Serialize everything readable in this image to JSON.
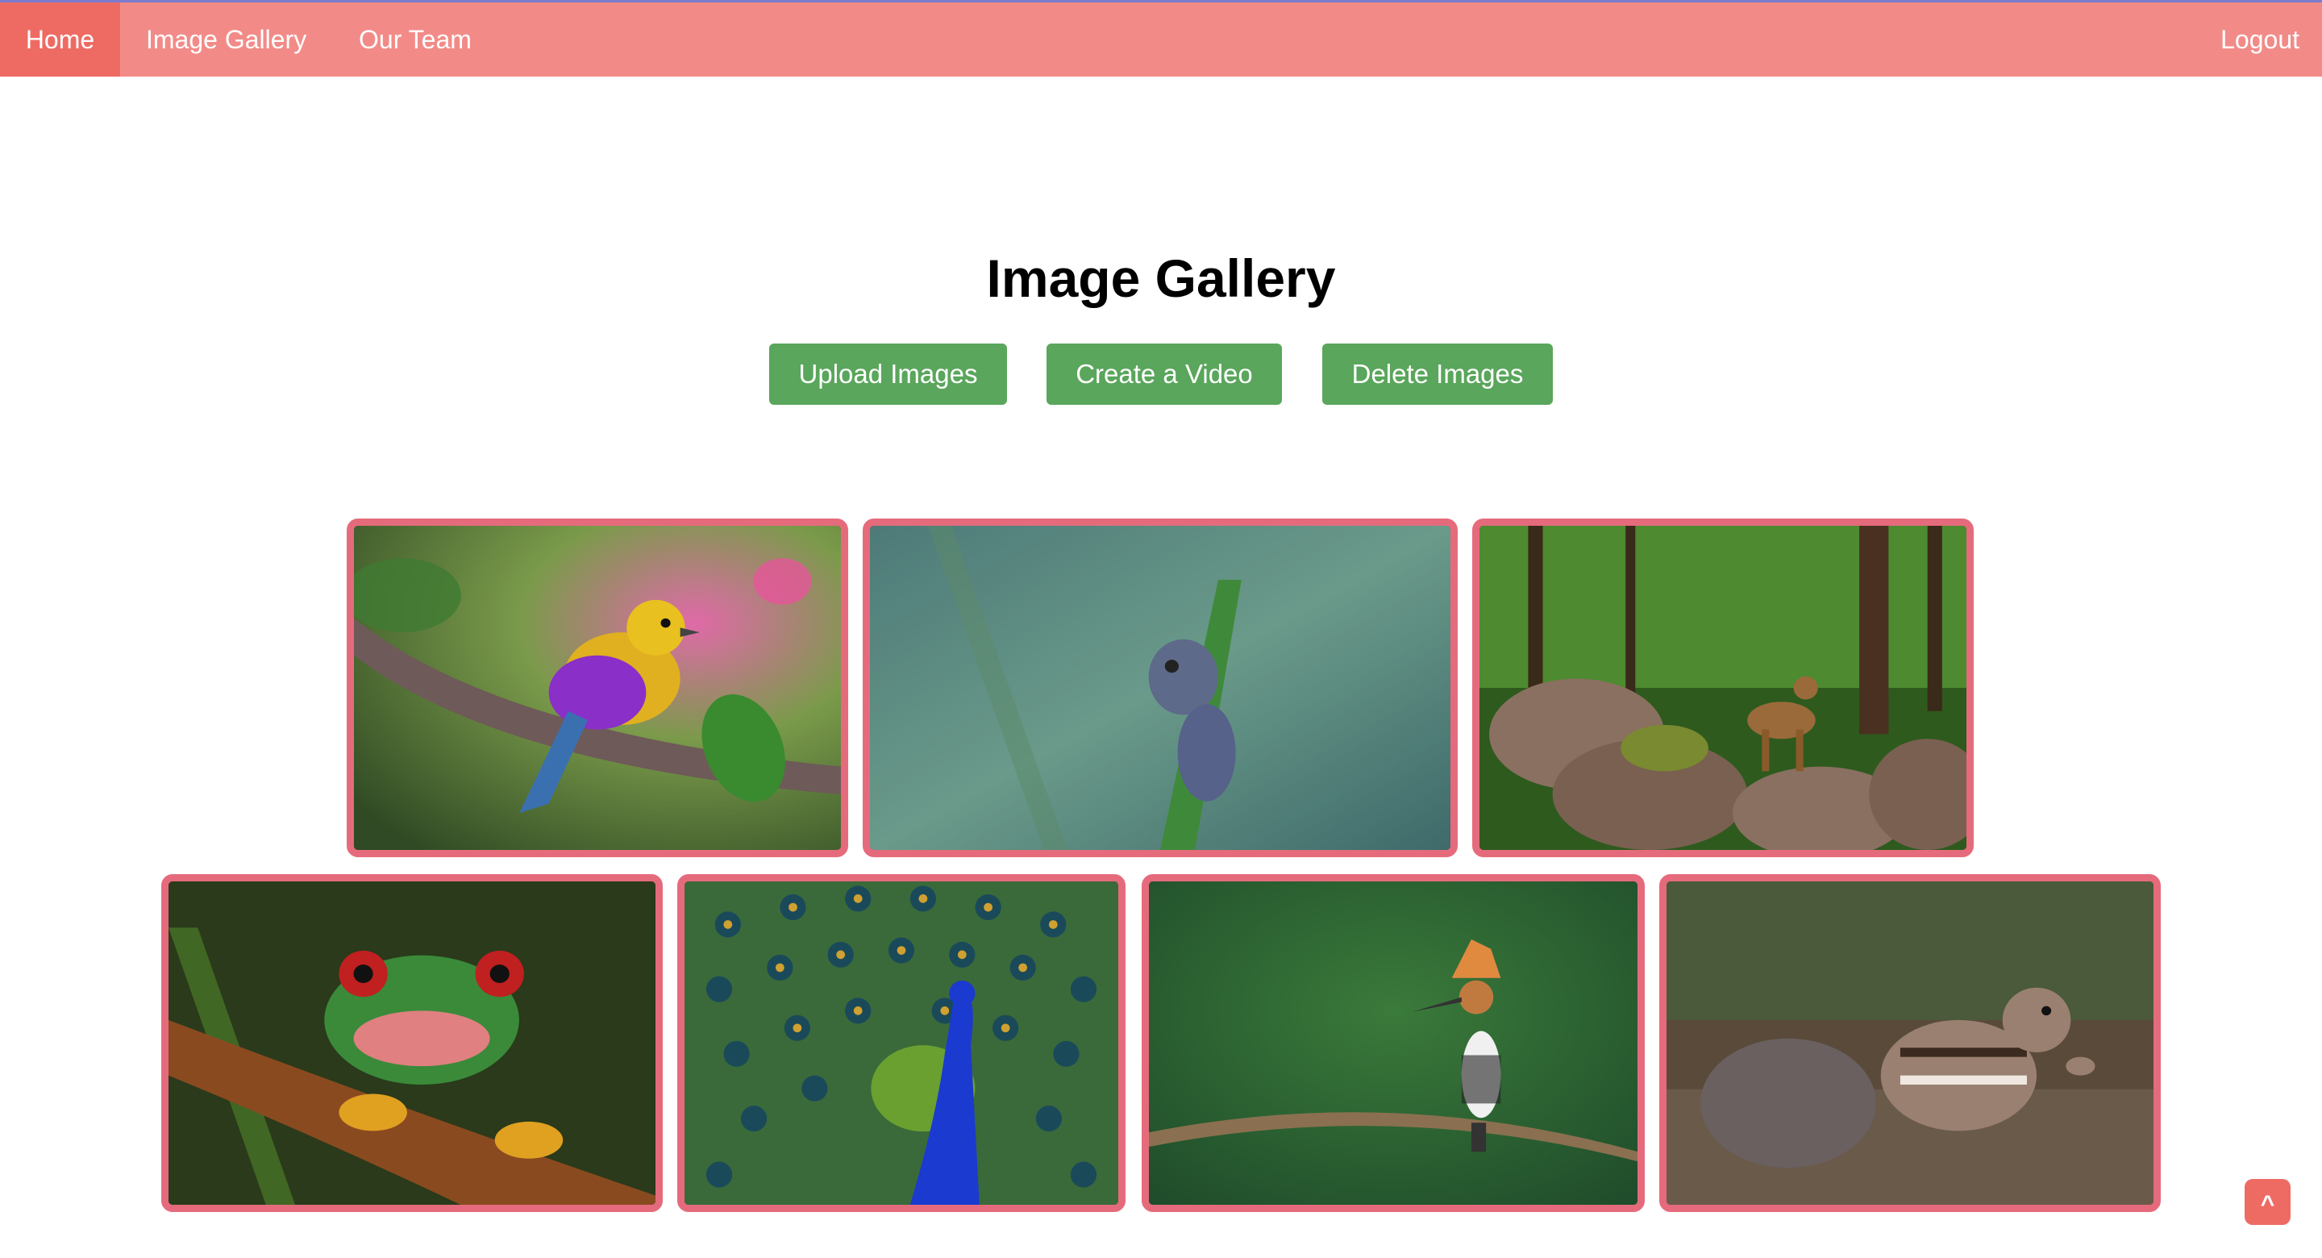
{
  "nav": {
    "home": "Home",
    "gallery": "Image Gallery",
    "team": "Our Team",
    "logout": "Logout"
  },
  "page": {
    "title": "Image Gallery"
  },
  "actions": {
    "upload": "Upload Images",
    "video": "Create a Video",
    "delete": "Delete Images"
  },
  "gallery": {
    "images": [
      {
        "subject": "colorful bird on branch"
      },
      {
        "subject": "chameleon on stem"
      },
      {
        "subject": "deer in forest"
      },
      {
        "subject": "red-eyed tree frog"
      },
      {
        "subject": "peacock"
      },
      {
        "subject": "hoopoe on branch"
      },
      {
        "subject": "chipmunk"
      }
    ]
  },
  "scroll_top": {
    "label": "^"
  },
  "colors": {
    "nav_bg": "#f28b88",
    "nav_active": "#ee6b64",
    "button": "#5aa65c",
    "card_border": "#e56b7c"
  }
}
